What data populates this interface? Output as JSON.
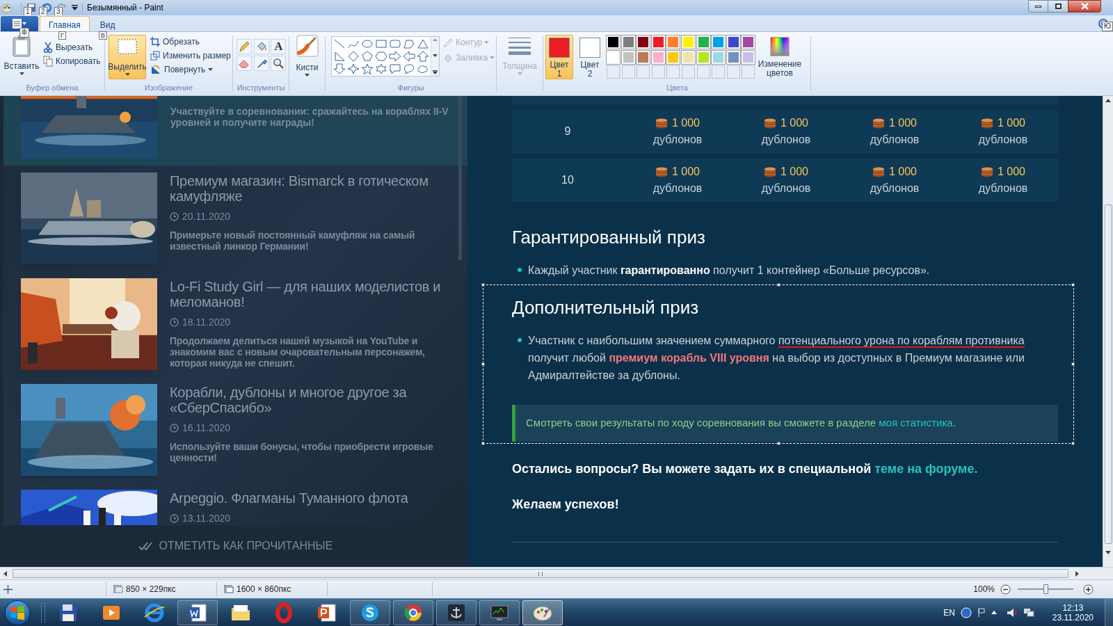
{
  "window": {
    "title": "Безымянный - Paint",
    "keytips": [
      "1",
      "2",
      "3"
    ]
  },
  "ribbon": {
    "file_keytip": "Ф",
    "tabs": [
      {
        "label": "Главная",
        "keytip": "Г",
        "selected": true
      },
      {
        "label": "Вид",
        "keytip": "В",
        "selected": false
      }
    ],
    "help_keytip": "Ю",
    "clipboard": {
      "label": "Буфер обмена",
      "paste": "Вставить",
      "cut": "Вырезать",
      "copy": "Копировать"
    },
    "image": {
      "label": "Изображение",
      "select": {
        "label": "Выделить",
        "selected": true
      },
      "crop": "Обрезать",
      "resize": "Изменить размер",
      "rotate": "Повернуть"
    },
    "tools": {
      "label": "Инструменты",
      "text_glyph": "A"
    },
    "brushes": {
      "label": "Кисти"
    },
    "shapes": {
      "label": "Фигуры",
      "outline": {
        "label": "Контур",
        "disabled": true
      },
      "fill": {
        "label": "Заливка",
        "disabled": true
      }
    },
    "size": {
      "label": "Толщина",
      "disabled": true
    },
    "colors": {
      "label": "Цвета",
      "color1": {
        "label": "Цвет 1",
        "color": "#ed1c24",
        "selected": true
      },
      "color2": {
        "label": "Цвет 2",
        "color": "#ffffff",
        "selected": false
      },
      "palette": [
        {
          "color": "#000000"
        },
        {
          "color": "#7f7f7f"
        },
        {
          "color": "#880015"
        },
        {
          "color": "#ed1c24"
        },
        {
          "color": "#ff7f27"
        },
        {
          "color": "#fff200"
        },
        {
          "color": "#22b14c"
        },
        {
          "color": "#00a2e8"
        },
        {
          "color": "#3f48cc"
        },
        {
          "color": "#a349a4"
        },
        {
          "color": "#ffffff"
        },
        {
          "color": "#c3c3c3"
        },
        {
          "color": "#b97a57"
        },
        {
          "color": "#ffaec9"
        },
        {
          "color": "#ffc90e"
        },
        {
          "color": "#efe4b0"
        },
        {
          "color": "#b5e61d"
        },
        {
          "color": "#99d9ea"
        },
        {
          "color": "#7092be"
        },
        {
          "color": "#c8bfe7"
        }
      ],
      "edit": "Изменение цветов"
    }
  },
  "news": {
    "items": [
      {
        "description": "Участвуйте в соревновании: сражайтесь на кораблях II-V уровней и получите награды!",
        "selected": true
      },
      {
        "title": "Премиум магазин: Bismarck в готическом камуфляже",
        "date": "20.11.2020",
        "description": "Примерьте новый постоянный камуфляж на самый известный линкор Германии!",
        "selected": false
      },
      {
        "title": "Lo-Fi Study Girl — для наших моделистов и меломанов!",
        "date": "18.11.2020",
        "description": "Продолжаем делиться нашей музыкой на YouTube и знакомим вас с новым очаровательным персонажем, которая никуда не спешит.",
        "selected": false
      },
      {
        "title": "Корабли, дублоны и многое другое за «СберСпасибо»",
        "date": "16.11.2020",
        "description": "Используйте ваши бонусы, чтобы приобрести игровые ценности!",
        "selected": false
      },
      {
        "title": "Arpeggio. Флагманы Туманного флота",
        "date": "13.11.2020",
        "selected": false
      }
    ],
    "mark_read": "ОТМЕТИТЬ КАК ПРОЧИТАННЫЕ"
  },
  "prize_table": {
    "rows": [
      {
        "place": "9",
        "prizes": [
          {
            "amount": "1 000",
            "unit": "дублонов"
          },
          {
            "amount": "1 000",
            "unit": "дублонов"
          },
          {
            "amount": "1 000",
            "unit": "дублонов"
          },
          {
            "amount": "1 000",
            "unit": "дублонов"
          }
        ]
      },
      {
        "place": "10",
        "prizes": [
          {
            "amount": "1 000",
            "unit": "дублонов"
          },
          {
            "amount": "1 000",
            "unit": "дублонов"
          },
          {
            "amount": "1 000",
            "unit": "дублонов"
          },
          {
            "amount": "1 000",
            "unit": "дублонов"
          }
        ]
      }
    ]
  },
  "sections": [
    {
      "heading": "Гарантированный приз",
      "bullets": [
        [
          {
            "text": "Каждый участник ",
            "kind": "plain",
            "scribbled": false
          },
          {
            "text": "гарантированно",
            "kind": "bold",
            "scribbled": false
          },
          {
            "text": " получит 1 контейнер «Больше ресурсов».",
            "kind": "plain",
            "scribbled": false
          }
        ]
      ]
    },
    {
      "heading": "Дополнительный приз",
      "bullets": [
        [
          {
            "text": "Участник с наибольшим значением суммарного ",
            "kind": "plain",
            "scribbled": false
          },
          {
            "text": "потенциального урона по кораблям противника",
            "kind": "plain",
            "scribbled": true
          },
          {
            "text": " получит любой ",
            "kind": "plain",
            "scribbled": false
          },
          {
            "text": "премиум корабль VIII уровня",
            "kind": "accent",
            "scribbled": false
          },
          {
            "text": " на выбор из доступных в Премиум магазине или Адмиралтействе за дублоны.",
            "kind": "plain",
            "scribbled": false
          }
        ]
      ]
    }
  ],
  "note": [
    {
      "text": "Смотреть свои результаты по ходу соревнования вы сможете в разделе ",
      "kind": "plain"
    },
    {
      "text": "моя статистика",
      "kind": "link"
    },
    {
      "text": ".",
      "kind": "plain"
    }
  ],
  "questions": [
    {
      "text": "Остались вопросы? Вы можете задать их в специальной ",
      "kind": "plain"
    },
    {
      "text": "теме на форуме.",
      "kind": "link"
    }
  ],
  "closing": "Желаем успехов!",
  "status_bar": {
    "selection_size": "850 × 229пкс",
    "canvas_size": "1600 × 860пкс",
    "zoom": "100%",
    "zoom_slider": {
      "level": 0.5
    }
  },
  "taskbar": {
    "language": "EN",
    "time": "12:13",
    "date": "23.11.2020"
  }
}
